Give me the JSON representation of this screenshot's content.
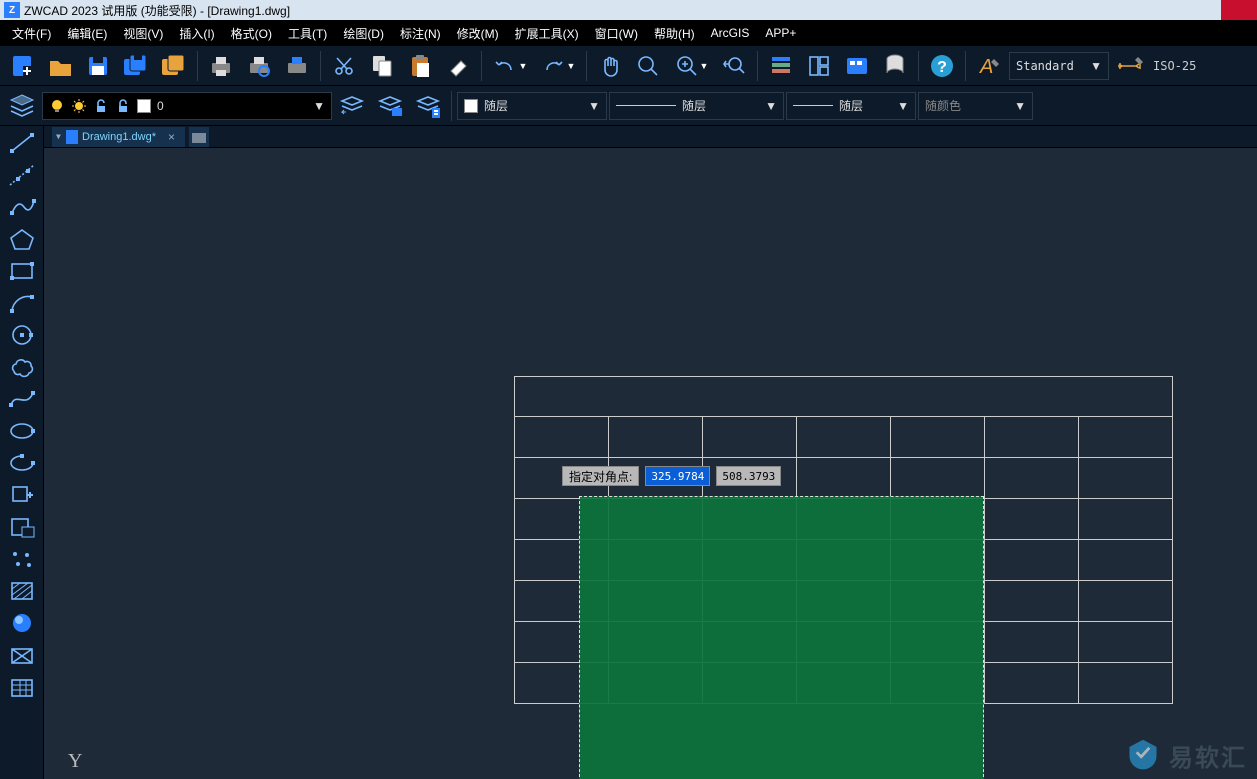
{
  "title": "ZWCAD 2023 试用版 (功能受限) - [Drawing1.dwg]",
  "menu": [
    "文件(F)",
    "编辑(E)",
    "视图(V)",
    "插入(I)",
    "格式(O)",
    "工具(T)",
    "绘图(D)",
    "标注(N)",
    "修改(M)",
    "扩展工具(X)",
    "窗口(W)",
    "帮助(H)",
    "ArcGIS",
    "APP+"
  ],
  "layer_combo": "0",
  "linetype_label1": "随层",
  "lineweight_label": "随层",
  "linetype_label2": "随层",
  "color_label": "随颜色",
  "style_label": "Standard",
  "dimstyle_label": "ISO-25",
  "tab_name": "Drawing1.dwg*",
  "dyn_prompt": "指定对角点:",
  "dyn_x": "325.9784",
  "dyn_y": "508.3793",
  "ucs_y": "Y",
  "watermark_text": "易软汇"
}
